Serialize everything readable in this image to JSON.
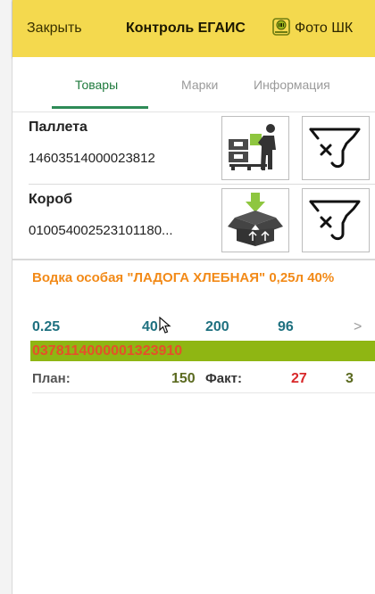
{
  "topbar": {
    "close_label": "Закрыть",
    "title": "Контроль ЕГАИС",
    "photo_label": "Фото ШК",
    "photo_icon": "camera-barcode-icon",
    "accent": "#f4d94e"
  },
  "tabs": [
    {
      "label": "Товары",
      "active": true
    },
    {
      "label": "Марки",
      "active": false
    },
    {
      "label": "Информация",
      "active": false
    }
  ],
  "pallet": {
    "label": "Паллета",
    "value": "14603514000023812",
    "action_icon": "warehouse-worker-icon",
    "clear_icon": "clear-signature-icon"
  },
  "box": {
    "label": "Короб",
    "value": "010054002523101180...",
    "action_icon": "box-arrow-icon",
    "clear_icon": "clear-signature-icon"
  },
  "product": {
    "name": "Водка особая \"ЛАДОГА ХЛЕБНАЯ\" 0,25л 40%",
    "volume": "0.25",
    "strength": "40",
    "count": "200",
    "extra": "96",
    "barcode": "0378114000001323910",
    "plan_label": "План:",
    "plan_value": "150",
    "fact_label": "Факт:",
    "fact_value": "27",
    "extra_value": "3",
    "name_color": "#f28a18",
    "barcode_bg": "#8fb613"
  }
}
